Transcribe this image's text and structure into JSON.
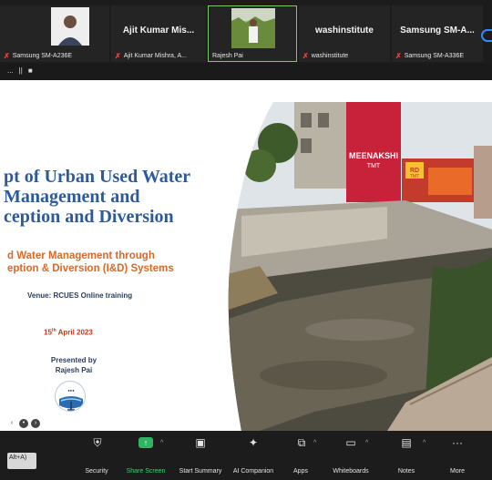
{
  "participants": [
    {
      "name": "",
      "label": "Samsung SM-A236E",
      "muted": true
    },
    {
      "name": "Ajit Kumar Mis...",
      "label": "Ajit Kumar Mishra, A...",
      "muted": true
    },
    {
      "name": "",
      "label": "Rajesh Pai",
      "muted": false
    },
    {
      "name": "washinstitute",
      "label": "washinstitute",
      "muted": true
    },
    {
      "name": "Samsung SM-A...",
      "label": "Samsung SM-A336E",
      "muted": true
    }
  ],
  "strip_controls": [
    "...",
    "||",
    "■"
  ],
  "slide": {
    "title_lines": [
      "pt of Urban Used Water",
      "Management and",
      "ception and Diversion"
    ],
    "subtitle_lines": [
      "d Water Management through",
      "eption & Diversion (I&D) Systems"
    ],
    "venue": "Venue: RCUES Online training",
    "date_day": "15",
    "date_suffix": "th",
    "date_rest": " April 2023",
    "presented_by": "Presented by",
    "presenter": "Rajesh Pai",
    "signboard_1": "MEENAKSHI",
    "signboard_1_sub": "TMT",
    "signboard_2": "RD",
    "signboard_2_sub": "TMT"
  },
  "toolbar": {
    "alt_label": "Alt+A)",
    "items": [
      {
        "label": "Security",
        "icon": "shield-icon"
      },
      {
        "label": "Share Screen",
        "icon": "share-screen-icon"
      },
      {
        "label": "Start Summary",
        "icon": "summary-icon"
      },
      {
        "label": "AI Companion",
        "icon": "sparkle-icon"
      },
      {
        "label": "Apps",
        "icon": "apps-icon"
      },
      {
        "label": "Whiteboards",
        "icon": "whiteboard-icon"
      },
      {
        "label": "Notes",
        "icon": "notes-icon"
      },
      {
        "label": "More",
        "icon": "more-icon"
      }
    ]
  },
  "colors": {
    "title": "#2d5a9b",
    "subtitle": "#d76a2a",
    "date": "#c43a1a",
    "share_green": "#2fb561",
    "mute_red": "#e2483d",
    "active_border": "#7ec96d"
  }
}
